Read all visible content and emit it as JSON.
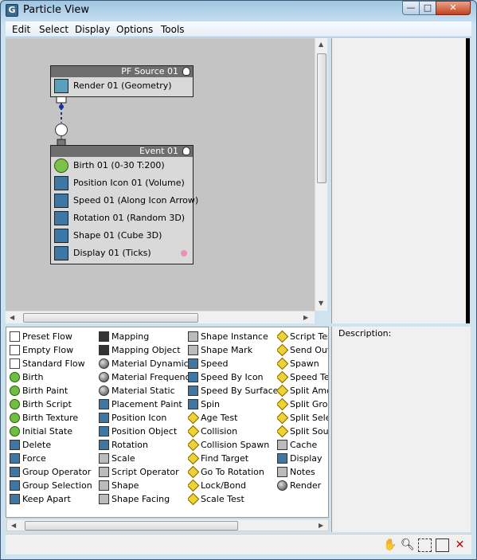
{
  "window": {
    "title": "Particle View",
    "app_icon_glyph": "G"
  },
  "window_controls": {
    "minimize": "—",
    "maximize": "□",
    "close": "✕"
  },
  "menu": [
    "Edit",
    "Select",
    "Display",
    "Options",
    "Tools"
  ],
  "nodes": {
    "source": {
      "title": "PF Source 01",
      "operators": [
        {
          "label": "Render 01 (Geometry)",
          "icon": "render-icon"
        }
      ]
    },
    "event": {
      "title": "Event 01",
      "operators": [
        {
          "label": "Birth 01 (0-30 T:200)",
          "icon": "birth-icon"
        },
        {
          "label": "Position Icon 01 (Volume)",
          "icon": "position-icon"
        },
        {
          "label": "Speed 01 (Along Icon Arrow)",
          "icon": "speed-icon"
        },
        {
          "label": "Rotation 01 (Random 3D)",
          "icon": "rotation-icon"
        },
        {
          "label": "Shape 01 (Cube 3D)",
          "icon": "shape-icon"
        },
        {
          "label": "Display 01 (Ticks)",
          "icon": "display-icon"
        }
      ]
    }
  },
  "depot": {
    "columns": [
      [
        "Preset Flow",
        "Empty Flow",
        "Standard Flow",
        "Birth",
        "Birth Paint",
        "Birth Script",
        "Birth Texture",
        "Initial State",
        "Delete",
        "Force",
        "Group Operator",
        "Group Selection",
        "Keep Apart"
      ],
      [
        "Mapping",
        "Mapping Object",
        "Material Dynamic",
        "Material Frequency",
        "Material Static",
        "Placement Paint",
        "Position Icon",
        "Position Object",
        "Rotation",
        "Scale",
        "Script Operator",
        "Shape",
        "Shape Facing"
      ],
      [
        "Shape Instance",
        "Shape Mark",
        "Speed",
        "Speed By Icon",
        "Speed By Surface",
        "Spin",
        "Age Test",
        "Collision",
        "Collision Spawn",
        "Find Target",
        "Go To Rotation",
        "Lock/Bond",
        "Scale Test"
      ],
      [
        "Script Tes",
        "Send Out",
        "Spawn",
        "Speed Tes",
        "Split Amou",
        "Split Grou",
        "Split Selec",
        "Split Sourc",
        "Cache",
        "Display",
        "Notes",
        "Render"
      ]
    ]
  },
  "description": {
    "label": "Description:"
  },
  "toolbar_icons": [
    "pan-icon",
    "zoom-icon",
    "zoom-region-icon",
    "zoom-extents-icon",
    "no-zoom-icon"
  ]
}
